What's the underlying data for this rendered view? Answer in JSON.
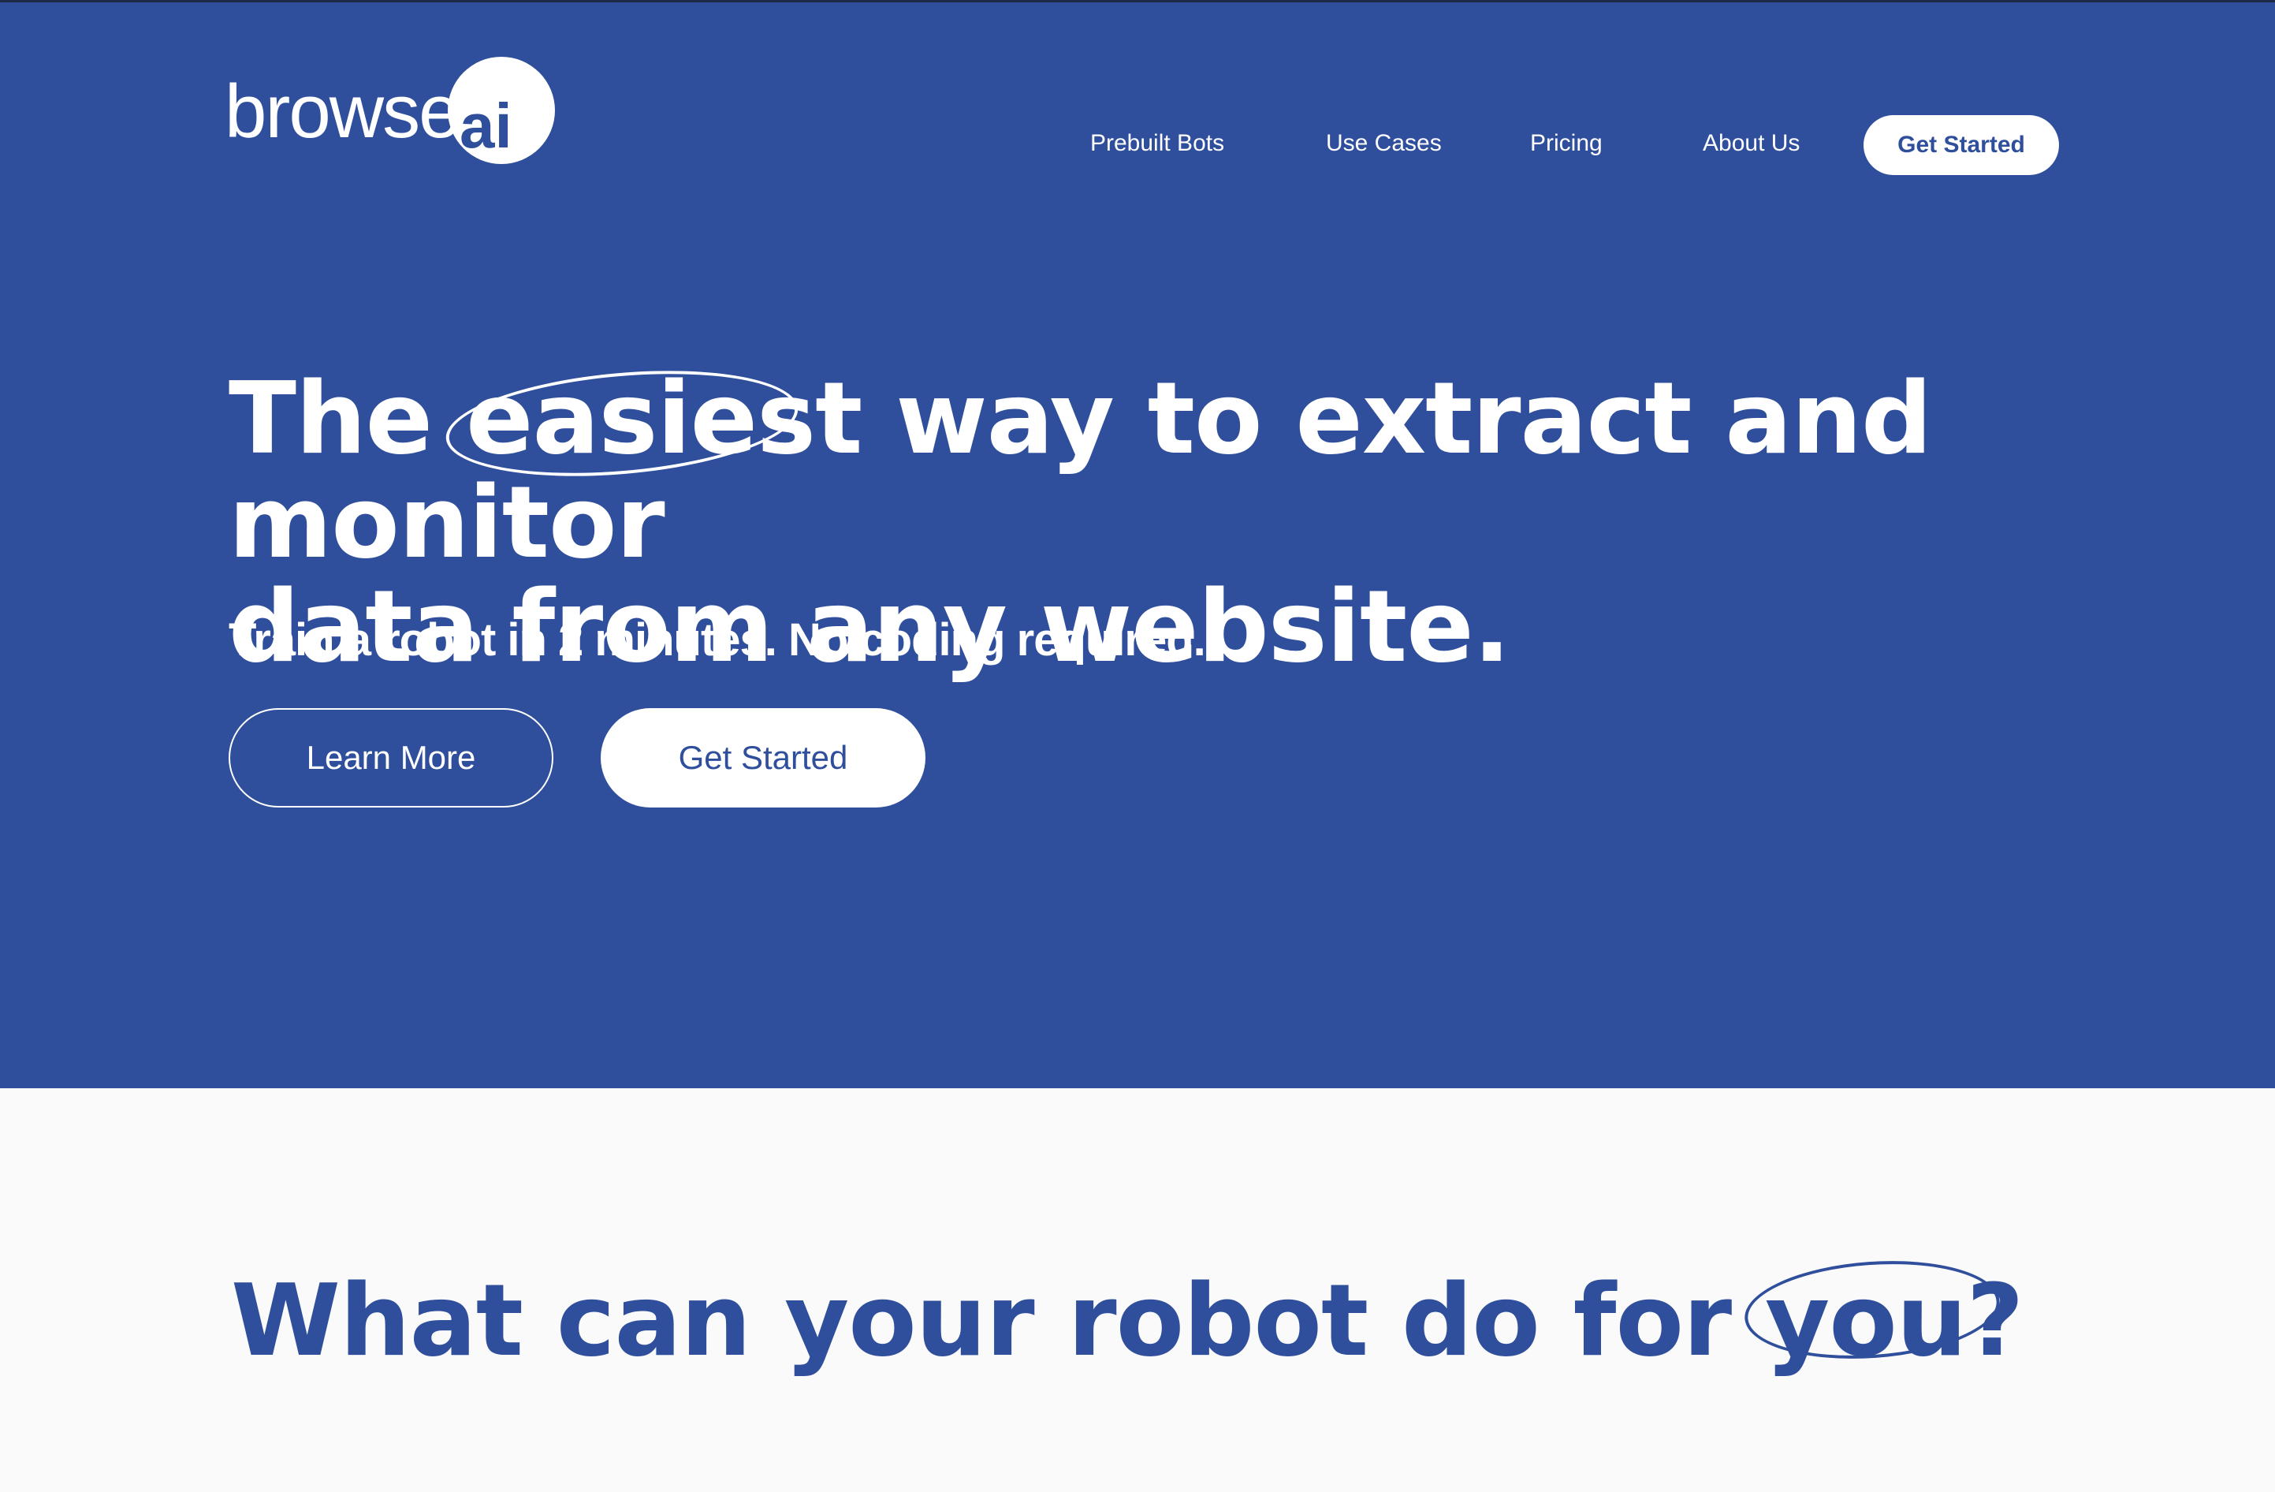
{
  "brand": {
    "logo_text": "browse",
    "logo_ai": "ai",
    "primary_color": "#2f4f9c",
    "light_color": "#ffffff",
    "background_color": "#fafafa"
  },
  "nav": {
    "items": [
      {
        "label": "Prebuilt Bots"
      },
      {
        "label": "Use Cases"
      },
      {
        "label": "Pricing"
      },
      {
        "label": "About Us"
      }
    ],
    "cta_label": "Get Started"
  },
  "hero": {
    "headline_before": "The ",
    "headline_highlight": "easiest",
    "headline_line1_after": " way to extract and monitor",
    "headline_line2": "data from any website.",
    "subheadline": "Train a robot in 2 minutes. No coding required.",
    "secondary_button": "Learn More",
    "primary_button": "Get Started"
  },
  "section": {
    "title_before": "What can your robot do for ",
    "title_highlight": "you?"
  }
}
